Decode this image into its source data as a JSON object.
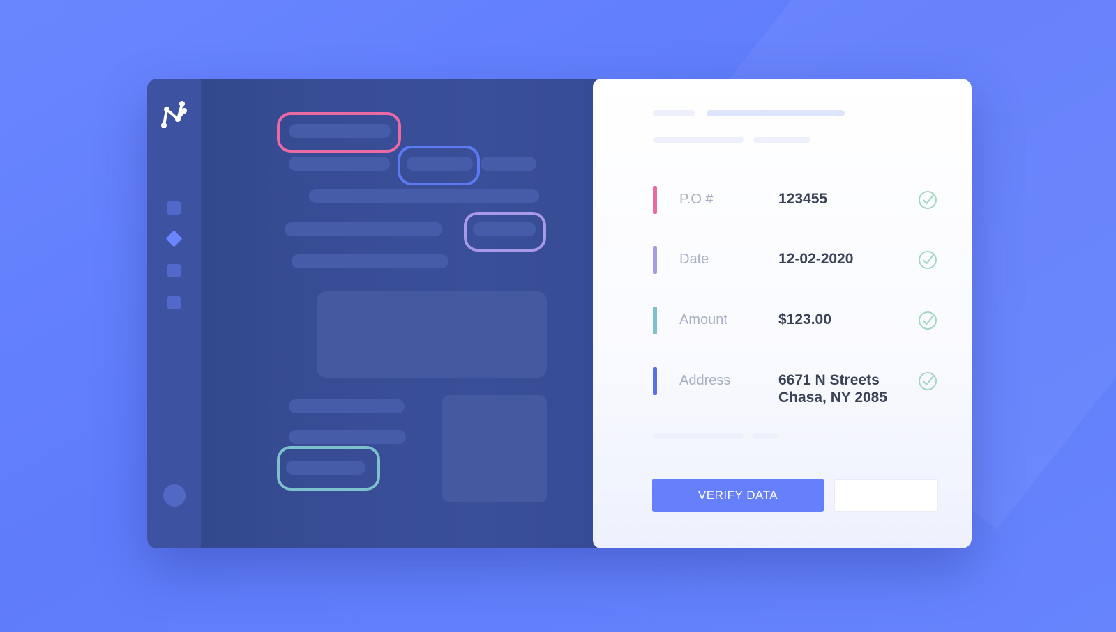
{
  "app": {
    "logo_icon": "network-logo-icon",
    "nav_icons": [
      "square-icon",
      "diamond-icon",
      "square-icon",
      "square-icon"
    ]
  },
  "highlight_colors": {
    "po": "#ec6aa3",
    "date": "#5c79f2",
    "amount": "#a89ae6",
    "address": "#7cc1cc"
  },
  "fields": [
    {
      "label": "P.O #",
      "value": "123455",
      "accent": "#ec6aa3",
      "status_icon": "check-circle-icon"
    },
    {
      "label": "Date",
      "value": "12-02-2020",
      "accent": "#a89ae6",
      "status_icon": "check-circle-icon"
    },
    {
      "label": "Amount",
      "value": "$123.00",
      "accent": "#7cc1cc",
      "status_icon": "check-circle-icon"
    },
    {
      "label": "Address",
      "value_line1": "6671 N Streets",
      "value_line2": "Chasa, NY 2085",
      "accent": "#5b6fe0",
      "status_icon": "check-circle-icon"
    }
  ],
  "actions": {
    "verify_label": "VERIFY DATA",
    "primary_color": "#6680fb"
  }
}
